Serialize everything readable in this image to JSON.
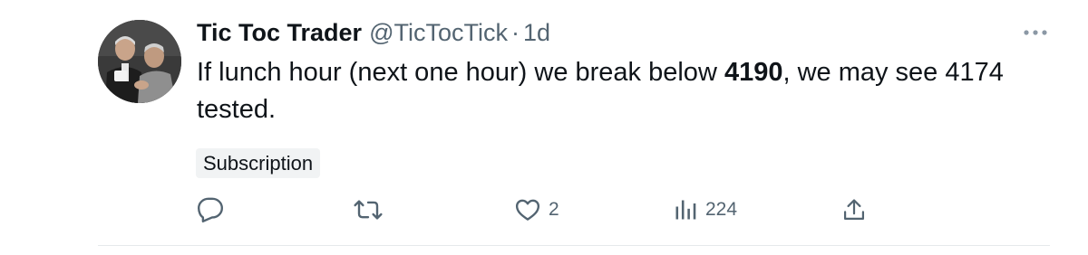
{
  "tweet": {
    "display_name": "Tic Toc Trader",
    "handle": "@TicTocTick",
    "separator": "·",
    "timestamp": "1d",
    "text_before": "If lunch hour (next one hour) we break below ",
    "text_bold": "4190",
    "text_after": ", we may see 4174 tested.",
    "badge": "Subscription"
  },
  "actions": {
    "reply": {
      "icon": "reply-icon",
      "count": ""
    },
    "retweet": {
      "icon": "retweet-icon",
      "count": ""
    },
    "like": {
      "icon": "heart-icon",
      "count": "2"
    },
    "views": {
      "icon": "bar-chart-icon",
      "count": "224"
    },
    "share": {
      "icon": "share-icon",
      "count": ""
    }
  },
  "colors": {
    "text": "#0f1419",
    "secondary": "#536471",
    "badge_bg": "#f1f3f4",
    "divider": "#e6e9eb"
  }
}
